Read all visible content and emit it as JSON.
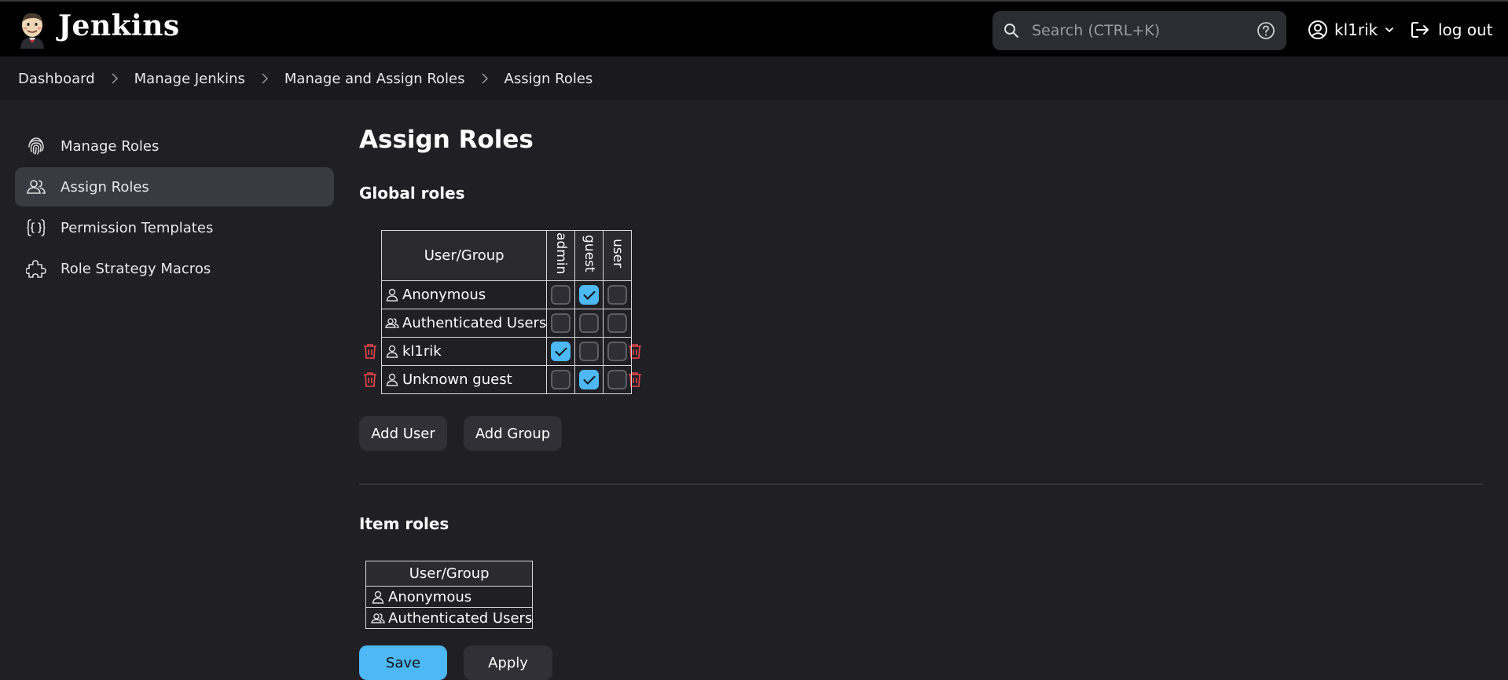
{
  "header": {
    "brand": "Jenkins",
    "search_placeholder": "Search (CTRL+K)",
    "username": "kl1rik",
    "logout_label": "log out"
  },
  "breadcrumb": [
    "Dashboard",
    "Manage Jenkins",
    "Manage and Assign Roles",
    "Assign Roles"
  ],
  "sidebar": {
    "items": [
      {
        "label": "Manage Roles",
        "icon": "fingerprint-icon",
        "active": false
      },
      {
        "label": "Assign Roles",
        "icon": "users-icon",
        "active": true
      },
      {
        "label": "Permission Templates",
        "icon": "braces-icon",
        "active": false
      },
      {
        "label": "Role Strategy Macros",
        "icon": "puzzle-icon",
        "active": false
      }
    ]
  },
  "main": {
    "title": "Assign Roles",
    "global": {
      "title": "Global roles",
      "header": "User/Group",
      "roles": [
        "admin",
        "guest",
        "user"
      ],
      "rows": [
        {
          "name": "Anonymous",
          "type": "user",
          "checks": [
            false,
            true,
            false
          ],
          "deletable": false
        },
        {
          "name": "Authenticated Users",
          "type": "group",
          "checks": [
            false,
            false,
            false
          ],
          "deletable": false
        },
        {
          "name": "kl1rik",
          "type": "user",
          "checks": [
            true,
            false,
            false
          ],
          "deletable": true
        },
        {
          "name": "Unknown guest",
          "type": "user",
          "checks": [
            false,
            true,
            false
          ],
          "deletable": true
        }
      ],
      "add_user": "Add User",
      "add_group": "Add Group"
    },
    "item": {
      "title": "Item roles",
      "header": "User/Group",
      "rows": [
        {
          "name": "Anonymous",
          "type": "user"
        },
        {
          "name": "Authenticated Users",
          "type": "group"
        }
      ]
    },
    "save_label": "Save",
    "apply_label": "Apply"
  },
  "colors": {
    "accent": "#4db8f5",
    "danger": "#e5484d",
    "header_bg": "#000000",
    "page_bg": "#1f1f24"
  }
}
